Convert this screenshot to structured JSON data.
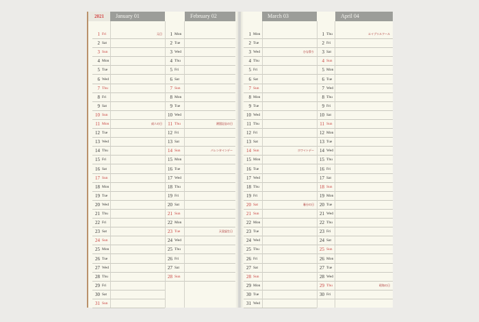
{
  "year": "2021",
  "months": [
    {
      "label": "January 01",
      "days": [
        {
          "n": "1",
          "w": "Fri",
          "red": true,
          "note": "元日"
        },
        {
          "n": "2",
          "w": "Sat"
        },
        {
          "n": "3",
          "w": "Sun",
          "red": true
        },
        {
          "n": "4",
          "w": "Mon"
        },
        {
          "n": "5",
          "w": "Tue"
        },
        {
          "n": "6",
          "w": "Wed"
        },
        {
          "n": "7",
          "w": "Thu",
          "red": true
        },
        {
          "n": "8",
          "w": "Fri"
        },
        {
          "n": "9",
          "w": "Sat"
        },
        {
          "n": "10",
          "w": "Sun",
          "red": true
        },
        {
          "n": "11",
          "w": "Mon",
          "red": true,
          "note": "成人の日"
        },
        {
          "n": "12",
          "w": "Tue"
        },
        {
          "n": "13",
          "w": "Wed"
        },
        {
          "n": "14",
          "w": "Thu"
        },
        {
          "n": "15",
          "w": "Fri"
        },
        {
          "n": "16",
          "w": "Sat"
        },
        {
          "n": "17",
          "w": "Sun",
          "red": true
        },
        {
          "n": "18",
          "w": "Mon"
        },
        {
          "n": "19",
          "w": "Tue"
        },
        {
          "n": "20",
          "w": "Wed"
        },
        {
          "n": "21",
          "w": "Thu"
        },
        {
          "n": "22",
          "w": "Fri"
        },
        {
          "n": "23",
          "w": "Sat"
        },
        {
          "n": "24",
          "w": "Sun",
          "red": true
        },
        {
          "n": "25",
          "w": "Mon"
        },
        {
          "n": "26",
          "w": "Tue"
        },
        {
          "n": "27",
          "w": "Wed"
        },
        {
          "n": "28",
          "w": "Thu"
        },
        {
          "n": "29",
          "w": "Fri"
        },
        {
          "n": "30",
          "w": "Sat"
        },
        {
          "n": "31",
          "w": "Sun",
          "red": true
        }
      ]
    },
    {
      "label": "February 02",
      "days": [
        {
          "n": "1",
          "w": "Mon"
        },
        {
          "n": "2",
          "w": "Tue"
        },
        {
          "n": "3",
          "w": "Wed"
        },
        {
          "n": "4",
          "w": "Thu"
        },
        {
          "n": "5",
          "w": "Fri"
        },
        {
          "n": "6",
          "w": "Sat"
        },
        {
          "n": "7",
          "w": "Sun",
          "red": true
        },
        {
          "n": "8",
          "w": "Mon"
        },
        {
          "n": "9",
          "w": "Tue"
        },
        {
          "n": "10",
          "w": "Wed"
        },
        {
          "n": "11",
          "w": "Thu",
          "red": true,
          "note": "建国記念の日"
        },
        {
          "n": "12",
          "w": "Fri"
        },
        {
          "n": "13",
          "w": "Sat"
        },
        {
          "n": "14",
          "w": "Sun",
          "red": true,
          "note": "バレンタインデー"
        },
        {
          "n": "15",
          "w": "Mon"
        },
        {
          "n": "16",
          "w": "Tue"
        },
        {
          "n": "17",
          "w": "Wed"
        },
        {
          "n": "18",
          "w": "Thu"
        },
        {
          "n": "19",
          "w": "Fri"
        },
        {
          "n": "20",
          "w": "Sat"
        },
        {
          "n": "21",
          "w": "Sun",
          "red": true
        },
        {
          "n": "22",
          "w": "Mon"
        },
        {
          "n": "23",
          "w": "Tue",
          "red": true,
          "note": "天皇誕生日"
        },
        {
          "n": "24",
          "w": "Wed"
        },
        {
          "n": "25",
          "w": "Thu"
        },
        {
          "n": "26",
          "w": "Fri"
        },
        {
          "n": "27",
          "w": "Sat"
        },
        {
          "n": "28",
          "w": "Sun",
          "red": true
        }
      ]
    },
    {
      "label": "March 03",
      "days": [
        {
          "n": "1",
          "w": "Mon"
        },
        {
          "n": "2",
          "w": "Tue"
        },
        {
          "n": "3",
          "w": "Wed",
          "note": "ひな祭り"
        },
        {
          "n": "4",
          "w": "Thu"
        },
        {
          "n": "5",
          "w": "Fri"
        },
        {
          "n": "6",
          "w": "Sat"
        },
        {
          "n": "7",
          "w": "Sun",
          "red": true
        },
        {
          "n": "8",
          "w": "Mon"
        },
        {
          "n": "9",
          "w": "Tue"
        },
        {
          "n": "10",
          "w": "Wed"
        },
        {
          "n": "11",
          "w": "Thu"
        },
        {
          "n": "12",
          "w": "Fri"
        },
        {
          "n": "13",
          "w": "Sat"
        },
        {
          "n": "14",
          "w": "Sun",
          "red": true,
          "note": "ホワイトデー"
        },
        {
          "n": "15",
          "w": "Mon"
        },
        {
          "n": "16",
          "w": "Tue"
        },
        {
          "n": "17",
          "w": "Wed"
        },
        {
          "n": "18",
          "w": "Thu"
        },
        {
          "n": "19",
          "w": "Fri"
        },
        {
          "n": "20",
          "w": "Sat",
          "red": true,
          "note": "春分の日"
        },
        {
          "n": "21",
          "w": "Sun",
          "red": true
        },
        {
          "n": "22",
          "w": "Mon"
        },
        {
          "n": "23",
          "w": "Tue"
        },
        {
          "n": "24",
          "w": "Wed"
        },
        {
          "n": "25",
          "w": "Thu"
        },
        {
          "n": "26",
          "w": "Fri"
        },
        {
          "n": "27",
          "w": "Sat"
        },
        {
          "n": "28",
          "w": "Sun",
          "red": true
        },
        {
          "n": "29",
          "w": "Mon"
        },
        {
          "n": "30",
          "w": "Tue"
        },
        {
          "n": "31",
          "w": "Wed"
        }
      ]
    },
    {
      "label": "April 04",
      "days": [
        {
          "n": "1",
          "w": "Thu",
          "note": "エイプリルフール"
        },
        {
          "n": "2",
          "w": "Fri"
        },
        {
          "n": "3",
          "w": "Sat"
        },
        {
          "n": "4",
          "w": "Sun",
          "red": true
        },
        {
          "n": "5",
          "w": "Mon"
        },
        {
          "n": "6",
          "w": "Tue"
        },
        {
          "n": "7",
          "w": "Wed"
        },
        {
          "n": "8",
          "w": "Thu"
        },
        {
          "n": "9",
          "w": "Fri"
        },
        {
          "n": "10",
          "w": "Sat"
        },
        {
          "n": "11",
          "w": "Sun",
          "red": true
        },
        {
          "n": "12",
          "w": "Mon"
        },
        {
          "n": "13",
          "w": "Tue"
        },
        {
          "n": "14",
          "w": "Wed"
        },
        {
          "n": "15",
          "w": "Thu"
        },
        {
          "n": "16",
          "w": "Fri"
        },
        {
          "n": "17",
          "w": "Sat"
        },
        {
          "n": "18",
          "w": "Sun",
          "red": true
        },
        {
          "n": "19",
          "w": "Mon"
        },
        {
          "n": "20",
          "w": "Tue"
        },
        {
          "n": "21",
          "w": "Wed"
        },
        {
          "n": "22",
          "w": "Thu"
        },
        {
          "n": "23",
          "w": "Fri"
        },
        {
          "n": "24",
          "w": "Sat"
        },
        {
          "n": "25",
          "w": "Sun",
          "red": true
        },
        {
          "n": "26",
          "w": "Mon"
        },
        {
          "n": "27",
          "w": "Tue"
        },
        {
          "n": "28",
          "w": "Wed"
        },
        {
          "n": "29",
          "w": "Thu",
          "red": true,
          "note": "昭和の日"
        },
        {
          "n": "30",
          "w": "Fri"
        }
      ]
    }
  ]
}
